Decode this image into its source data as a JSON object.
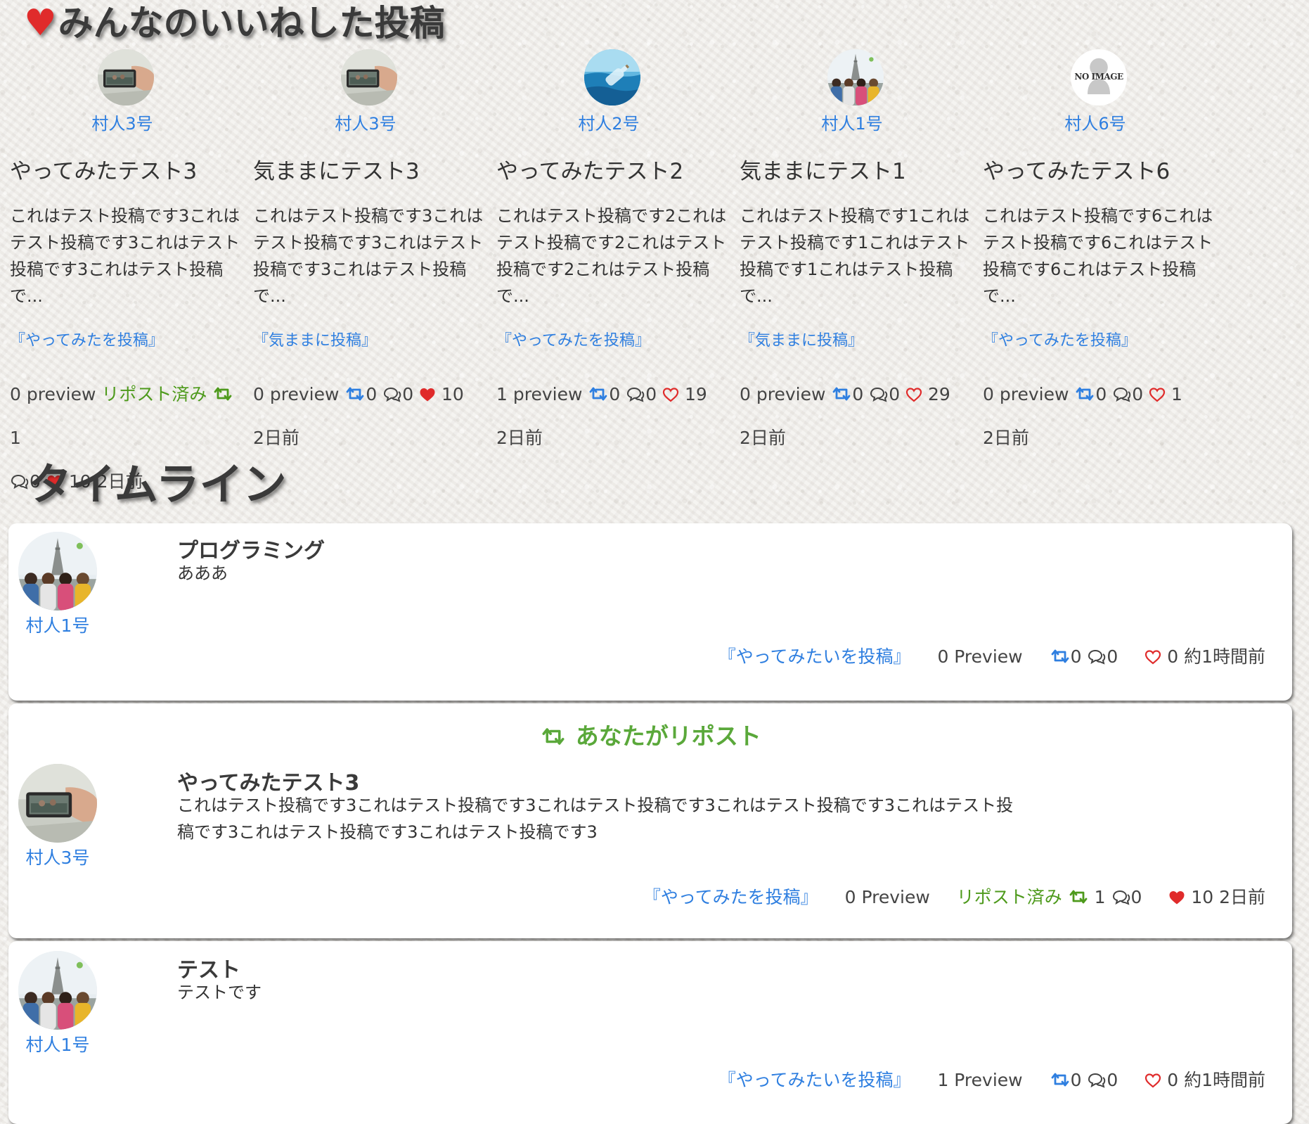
{
  "favorites": {
    "title": "みんなのいいねした投稿",
    "title_icon": "heart-icon",
    "posts": [
      {
        "user": "村人3号",
        "avatar": "phone-photo",
        "title": "やってみたテスト3",
        "body": "これはテスト投稿です3これはテスト投稿です3これはテスト投稿です3これはテスト投稿で...",
        "category": "『やってみたを投稿』",
        "preview": "0 preview",
        "repost_status": "リポスト済み",
        "reposts": "1",
        "comments": "0",
        "likes": "10",
        "liked": true,
        "reposted": true,
        "time": "2日前"
      },
      {
        "user": "村人3号",
        "avatar": "phone-photo",
        "title": "気ままにテスト3",
        "body": "これはテスト投稿です3これはテスト投稿です3これはテスト投稿です3これはテスト投稿で...",
        "category": "『気ままに投稿』",
        "preview": "0 preview",
        "reposts": "0",
        "comments": "0",
        "likes": "10",
        "liked": true,
        "reposted": false,
        "time": "2日前"
      },
      {
        "user": "村人2号",
        "avatar": "bottle-sea",
        "title": "やってみたテスト2",
        "body": "これはテスト投稿です2これはテスト投稿です2これはテスト投稿です2これはテスト投稿で...",
        "category": "『やってみたを投稿』",
        "preview": "1 preview",
        "reposts": "0",
        "comments": "0",
        "likes": "19",
        "liked": false,
        "reposted": false,
        "time": "2日前"
      },
      {
        "user": "村人1号",
        "avatar": "friends-tower",
        "title": "気ままにテスト1",
        "body": "これはテスト投稿です1これはテスト投稿です1これはテスト投稿です1これはテスト投稿で...",
        "category": "『気ままに投稿』",
        "preview": "0 preview",
        "reposts": "0",
        "comments": "0",
        "likes": "29",
        "liked": false,
        "reposted": false,
        "time": "2日前"
      },
      {
        "user": "村人6号",
        "avatar": "no-image",
        "avatar_text": "NO IMAGE",
        "title": "やってみたテスト6",
        "body": "これはテスト投稿です6これはテスト投稿です6これはテスト投稿です6これはテスト投稿で...",
        "category": "『やってみたを投稿』",
        "preview": "0 preview",
        "reposts": "0",
        "comments": "0",
        "likes": "1",
        "liked": false,
        "reposted": false,
        "time": "2日前"
      }
    ]
  },
  "timeline": {
    "title": "タイムライン",
    "posts": [
      {
        "user": "村人1号",
        "avatar": "friends-tower",
        "title": "プログラミング",
        "body": "あああ",
        "category": "『やってみたいを投稿』",
        "preview": "0 Preview",
        "reposts": "0",
        "comments": "0",
        "likes": "0",
        "liked": false,
        "reposted": false,
        "time": "約1時間前"
      },
      {
        "banner": "あなたがリポスト",
        "user": "村人3号",
        "avatar": "phone-photo",
        "title": "やってみたテスト3",
        "body": "これはテスト投稿です3これはテスト投稿です3これはテスト投稿です3これはテスト投稿です3これはテスト投稿です3これはテスト投稿です3これはテスト投稿です3",
        "category": "『やってみたを投稿』",
        "preview": "0 Preview",
        "repost_status": "リポスト済み",
        "reposts": "1",
        "comments": "0",
        "likes": "10",
        "liked": true,
        "reposted": true,
        "time": "2日前"
      },
      {
        "user": "村人1号",
        "avatar": "friends-tower",
        "title": "テスト",
        "body": "テストです",
        "category": "『やってみたいを投稿』",
        "preview": "1 Preview",
        "reposts": "0",
        "comments": "0",
        "likes": "0",
        "liked": false,
        "reposted": false,
        "time": "約1時間前"
      }
    ]
  },
  "icons": {
    "repost": "repost-icon",
    "comment": "comment-icon",
    "like": "heart-icon"
  },
  "colors": {
    "link": "#2f7fe0",
    "reposted": "#4e9a1c",
    "heart": "#e02b2b",
    "banner": "#5aa83a"
  }
}
